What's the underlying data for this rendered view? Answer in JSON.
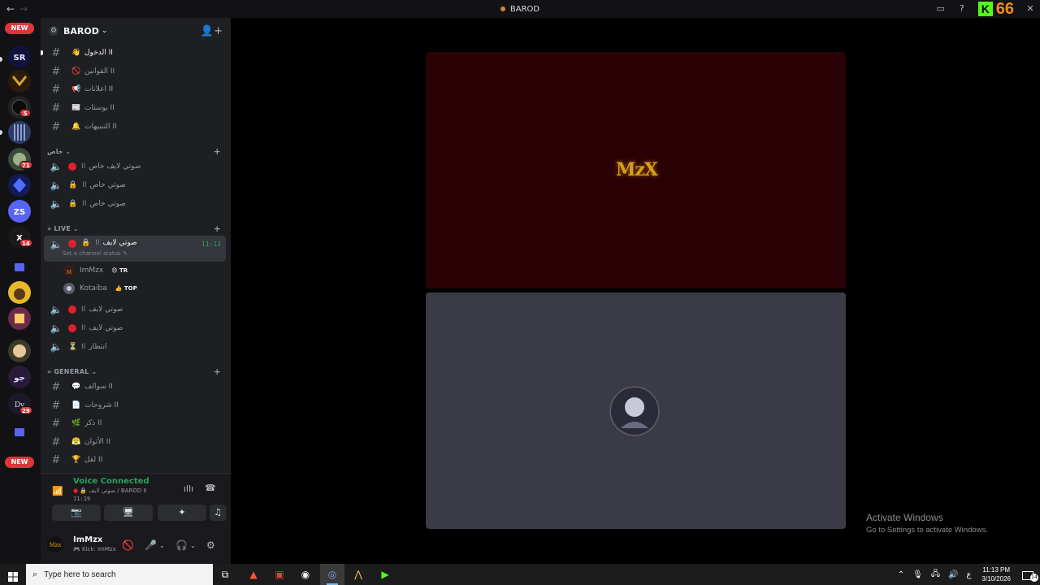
{
  "window": {
    "title": "BAROD",
    "kick_count": "66"
  },
  "rail": {
    "new_badge": "NEW",
    "server_badges": [
      "5",
      "71",
      "14",
      "29"
    ]
  },
  "guild": {
    "name": "BAROD"
  },
  "text_channels_top": [
    {
      "emoji": "👋",
      "name": "الدخول ꓲꓲ"
    },
    {
      "emoji": "🚫",
      "name": "القوانين ꓲꓲ"
    },
    {
      "emoji": "📢",
      "name": "اعلانات ꓲꓲ"
    },
    {
      "emoji": "📰",
      "name": "بوستات ꓲꓲ"
    },
    {
      "emoji": "🔔",
      "name": "التنبيهات ꓲꓲ"
    }
  ],
  "categories": {
    "private": "خاص",
    "live": "LIVE",
    "general": "GENERAL"
  },
  "private_channels": [
    {
      "name": "صوتي لايف خاص"
    },
    {
      "name": "صوتي خاص"
    },
    {
      "name": "صوتي خاص"
    }
  ],
  "live": {
    "active_channel": "صوتي لايف",
    "active_time": "11:13",
    "status_placeholder": "Set a channel status",
    "users": [
      {
        "name": "ImMzx",
        "tag": "TR"
      },
      {
        "name": "Kotaiba",
        "tag": "TOP"
      }
    ],
    "other_channels": [
      {
        "name": "صوتي لايف"
      },
      {
        "name": "صوتي لايف"
      },
      {
        "name": "انتظار"
      }
    ]
  },
  "general_channels": [
    {
      "emoji": "💬",
      "name": "سوالف ꓲꓲ"
    },
    {
      "emoji": "📄",
      "name": "شروحات ꓲꓲ"
    },
    {
      "emoji": "🌿",
      "name": "ذكر ꓲꓲ"
    },
    {
      "emoji": "😤",
      "name": "الأثوان ꓲꓲ"
    },
    {
      "emoji": "🏆",
      "name": "لقل ꓲꓲ"
    }
  ],
  "voice": {
    "title": "Voice Connected",
    "subtitle": "صوتي لايف / BAROD ꓲꓲ",
    "timer": "11:19"
  },
  "user": {
    "name": "ImMzx",
    "status": "Kick: ImMzx"
  },
  "stage": {
    "logo_text": "MzX"
  },
  "watermark": {
    "line1": "Activate Windows",
    "line2": "Go to Settings to activate Windows."
  },
  "taskbar": {
    "search_placeholder": "Type here to search",
    "time": "11:13 PM",
    "date": "3/10/2026",
    "notifications": "14",
    "lang": "ع"
  },
  "colors": {
    "accent_green": "#23a55a",
    "badge_red": "#da373c",
    "blurple": "#5865f2",
    "kick_green": "#53fc18",
    "kick_orange": "#f28c1a"
  }
}
